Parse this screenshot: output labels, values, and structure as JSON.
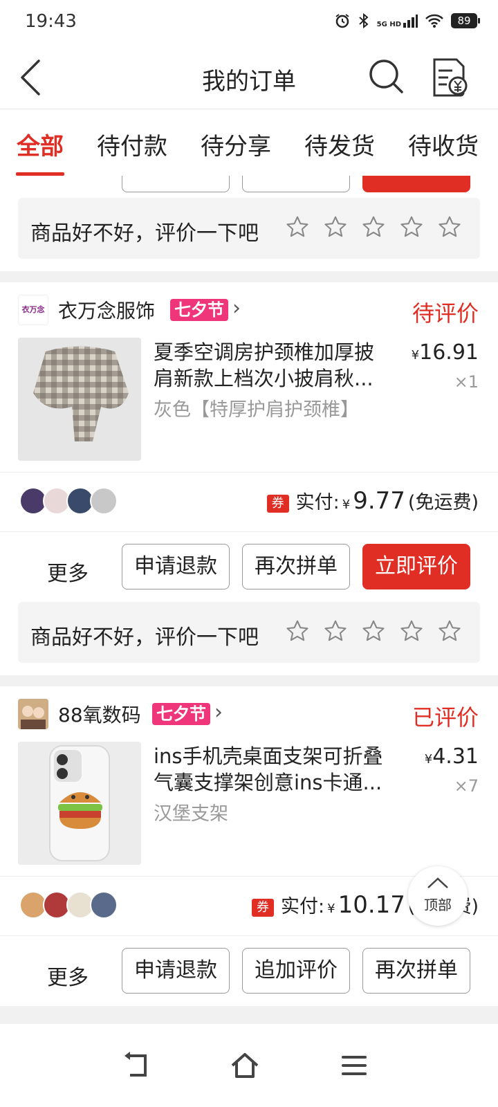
{
  "status_bar": {
    "time": "19:43",
    "network": "5G HD",
    "battery": "89"
  },
  "header": {
    "title": "我的订单"
  },
  "tabs": [
    {
      "label": "全部",
      "active": true
    },
    {
      "label": "待付款",
      "active": false
    },
    {
      "label": "待分享",
      "active": false
    },
    {
      "label": "待发货",
      "active": false
    },
    {
      "label": "待收货",
      "active": false
    }
  ],
  "rate_prompt": "商品好不好，评价一下吧",
  "orders": [
    {
      "shop": "衣万念服饰",
      "shop_logo_text": "衣万念",
      "festival_tag": "七夕节",
      "status": "待评价",
      "product_title": "夏季空调房护颈椎加厚披肩新款上档次小披肩秋...",
      "spec": "灰色【特厚护肩护颈椎】",
      "price_symbol": "¥",
      "price": "16.91",
      "qty": "×1",
      "coupon": "券",
      "paid_label": "实付:",
      "paid_symbol": "¥",
      "paid_amount": "9.77",
      "shipping": "(免运费)",
      "buttons": {
        "more": "更多",
        "refund": "申请退款",
        "rebuy": "再次拼单",
        "rate": "立即评价"
      }
    },
    {
      "shop": "88氧数码",
      "festival_tag": "七夕节",
      "status": "已评价",
      "product_title": "ins手机壳桌面支架可折叠气囊支撑架创意ins卡通...",
      "spec": "汉堡支架",
      "price_symbol": "¥",
      "price": "4.31",
      "qty": "×7",
      "coupon": "券",
      "paid_label": "实付:",
      "paid_symbol": "¥",
      "paid_amount": "10.17",
      "shipping": "(免运费)",
      "buttons": {
        "more": "更多",
        "refund": "申请退款",
        "add_review": "追加评价",
        "rebuy": "再次拼单"
      }
    }
  ],
  "top_button": "顶部",
  "colors": {
    "accent": "#e02e24",
    "festival": "#f0367a"
  },
  "icons": [
    "back-arrow-icon",
    "search-icon",
    "bill-icon",
    "star-icon",
    "chevron-right-icon",
    "back-nav-icon",
    "home-nav-icon",
    "menu-nav-icon"
  ]
}
